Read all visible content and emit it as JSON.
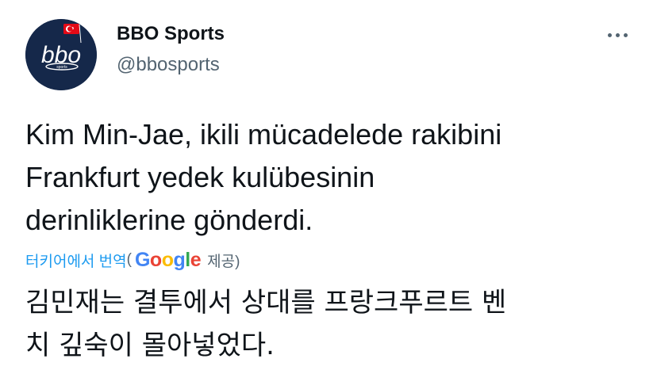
{
  "author": {
    "display_name": "BBO Sports",
    "handle": "@bbosports",
    "avatar": {
      "logo_text": "bbo",
      "logo_subtext": "sports",
      "background_color": "#15284a",
      "flag": "turkey-flag"
    }
  },
  "more_menu": {
    "icon": "more-horizontal-icon"
  },
  "tweet": {
    "text_lines": [
      "Kim Min-Jae, ikili mücadelede rakibini",
      "Frankfurt yedek kulübesinin",
      "derinliklerine gönderdi."
    ]
  },
  "translation": {
    "link_label": "터키어에서 번역",
    "open_paren": "(",
    "provider_logo": {
      "letters": [
        "G",
        "o",
        "o",
        "g",
        "l",
        "e"
      ],
      "colors": [
        "#4285f4",
        "#ea4335",
        "#fbbc05",
        "#4285f4",
        "#34a853",
        "#ea4335"
      ]
    },
    "provided_label": "제공)",
    "text_lines": [
      "김민재는 결투에서 상대를 프랑크푸르트 벤",
      "치 깊숙이 몰아넣었다."
    ]
  },
  "colors": {
    "primary_text": "#0f1419",
    "secondary_text": "#536471",
    "link": "#1d9bf0"
  }
}
